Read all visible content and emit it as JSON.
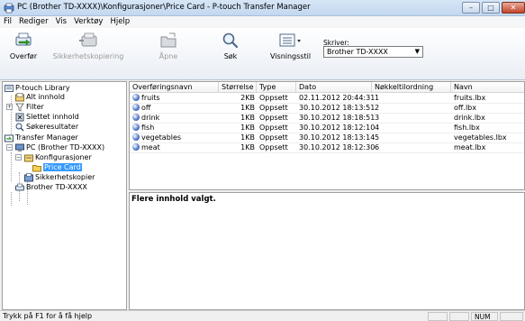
{
  "window": {
    "title": "PC (Brother TD-XXXX)\\Konfigurasjoner\\Price Card - P-touch Transfer Manager",
    "minimize_glyph": "–",
    "maximize_glyph": "□",
    "close_glyph": "✕"
  },
  "menu": {
    "items": [
      "Fil",
      "Rediger",
      "Vis",
      "Verktøy",
      "Hjelp"
    ]
  },
  "toolbar": {
    "buttons": [
      {
        "label": "Overfør",
        "icon": "transfer-icon",
        "enabled": true
      },
      {
        "label": "Sikkerhetskopiering",
        "icon": "backup-icon",
        "enabled": false
      },
      {
        "label": "Åpne",
        "icon": "open-icon",
        "enabled": false
      },
      {
        "label": "Søk",
        "icon": "search-icon",
        "enabled": true
      },
      {
        "label": "Visningsstil",
        "icon": "view-style-icon",
        "enabled": true
      }
    ],
    "printer_label": "Skriver:",
    "printer_value": "Brother TD-XXXX"
  },
  "tree": {
    "items": [
      {
        "label": "P-touch Library",
        "icon": "library-icon"
      },
      {
        "label": "Alt innhold",
        "icon": "all-content-icon"
      },
      {
        "label": "Filter",
        "icon": "filter-icon"
      },
      {
        "label": "Slettet innhold",
        "icon": "deleted-content-icon"
      },
      {
        "label": "Søkeresultater",
        "icon": "search-results-icon"
      },
      {
        "label": "Transfer Manager",
        "icon": "transfer-manager-icon"
      },
      {
        "label": "PC (Brother TD-XXXX)",
        "icon": "pc-icon"
      },
      {
        "label": "Konfigurasjoner",
        "icon": "configurations-icon"
      },
      {
        "label": "Price Card",
        "icon": "folder-icon",
        "selected": true
      },
      {
        "label": "Sikkerhetskopier",
        "icon": "backups-icon"
      },
      {
        "label": "Brother TD-XXXX",
        "icon": "printer-icon"
      }
    ]
  },
  "list": {
    "columns": [
      "Overføringsnavn",
      "Størrelse",
      "Type",
      "Dato",
      "Nøkkeltilordning",
      "Navn"
    ],
    "rows": [
      [
        "fruits",
        "2KB",
        "Oppsett",
        "02.11.2012 20:44:31",
        "1",
        "fruits.lbx"
      ],
      [
        "off",
        "1KB",
        "Oppsett",
        "30.10.2012 18:13:51",
        "2",
        "off.lbx"
      ],
      [
        "drink",
        "1KB",
        "Oppsett",
        "30.10.2012 18:18:51",
        "3",
        "drink.lbx"
      ],
      [
        "fish",
        "1KB",
        "Oppsett",
        "30.10.2012 18:12:10",
        "4",
        "fish.lbx"
      ],
      [
        "vegetables",
        "1KB",
        "Oppsett",
        "30.10.2012 18:13:14",
        "5",
        "vegetables.lbx"
      ],
      [
        "meat",
        "1KB",
        "Oppsett",
        "30.10.2012 18:12:30",
        "6",
        "meat.lbx"
      ]
    ]
  },
  "preview": {
    "message": "Flere innhold valgt."
  },
  "status": {
    "help_text": "Trykk på F1 for å få hjelp",
    "num_indicator": "NUM"
  },
  "colors": {
    "selection": "#3399ff",
    "titlebar": "#c9dcf1",
    "close_button": "#c4452b"
  }
}
